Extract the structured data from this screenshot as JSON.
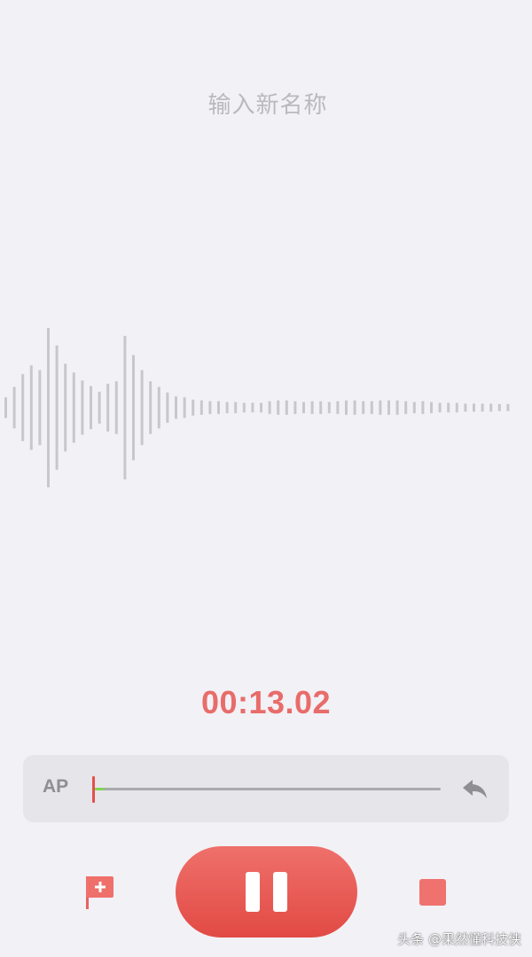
{
  "recording": {
    "name_placeholder": "输入新名称",
    "name_value": "",
    "elapsed_time": "00:13.02"
  },
  "ab_repeat": {
    "label": "AP",
    "progress_fraction": 0.03
  },
  "controls": {
    "flag_icon": "add-flag-icon",
    "pause_icon": "pause-icon",
    "stop_icon": "stop-icon",
    "reply_icon": "reply-arrow-icon"
  },
  "waveform": {
    "amplitudes": [
      0.13,
      0.26,
      0.42,
      0.53,
      0.47,
      1.0,
      0.78,
      0.55,
      0.44,
      0.34,
      0.27,
      0.2,
      0.3,
      0.33,
      0.9,
      0.66,
      0.47,
      0.33,
      0.26,
      0.19,
      0.14,
      0.13,
      0.1,
      0.09,
      0.08,
      0.08,
      0.07,
      0.07,
      0.06,
      0.06,
      0.06,
      0.08,
      0.09,
      0.09,
      0.08,
      0.07,
      0.08,
      0.08,
      0.07,
      0.08,
      0.09,
      0.09,
      0.08,
      0.08,
      0.09,
      0.09,
      0.09,
      0.08,
      0.07,
      0.08,
      0.07,
      0.06,
      0.06,
      0.06,
      0.05,
      0.05,
      0.05,
      0.05,
      0.04,
      0.04
    ]
  },
  "colors": {
    "accent": "#e86c6a",
    "background": "#f2f1f6",
    "wave": "#c8c7cc",
    "progress": "#7ed651"
  },
  "watermark": {
    "text": "头条 @果然懂科技侠"
  }
}
